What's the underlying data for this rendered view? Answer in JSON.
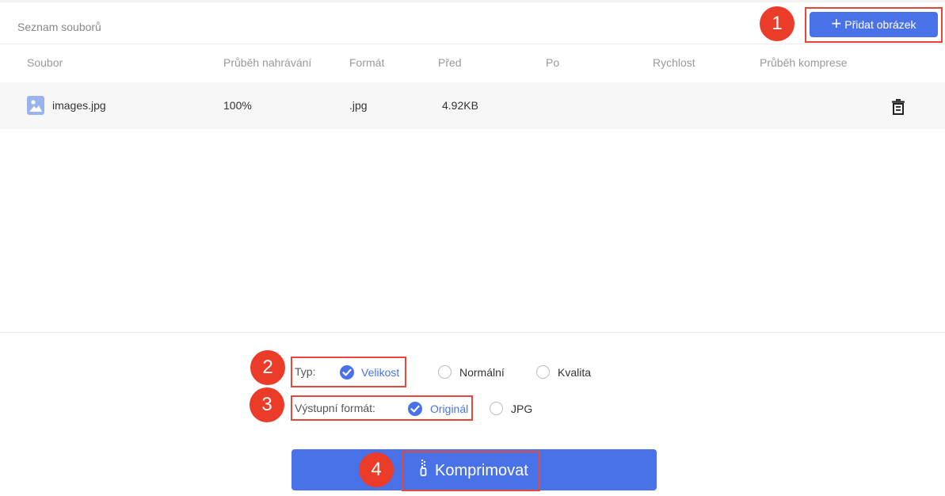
{
  "header": {
    "title": "Seznam souborů",
    "add_button_label": "Přidat obrázek"
  },
  "steps": [
    "1",
    "2",
    "3",
    "4"
  ],
  "table": {
    "columns": [
      "Soubor",
      "Průběh nahrávání",
      "Formát",
      "Před",
      "Po",
      "Rychlost",
      "Průběh komprese"
    ],
    "rows": [
      {
        "name": "images.jpg",
        "progress": "100%",
        "format": ".jpg",
        "before": "4.92KB",
        "after": "",
        "speed": "",
        "compress_progress": ""
      }
    ]
  },
  "options": {
    "type_label": "Typ:",
    "type_options": [
      "Velikost",
      "Normální",
      "Kvalita"
    ],
    "type_selected": "Velikost",
    "output_label": "Výstupní formát:",
    "output_options": [
      "Originál",
      "JPG"
    ],
    "output_selected": "Originál"
  },
  "compress_button_label": "Komprimovat",
  "colors": {
    "accent": "#4a72e8",
    "step_badge": "#ea3c29",
    "highlight_box": "#e5483a"
  },
  "icons": [
    "plus-icon",
    "image-file-icon",
    "trash-icon",
    "checkmark-icon",
    "zip-icon"
  ]
}
